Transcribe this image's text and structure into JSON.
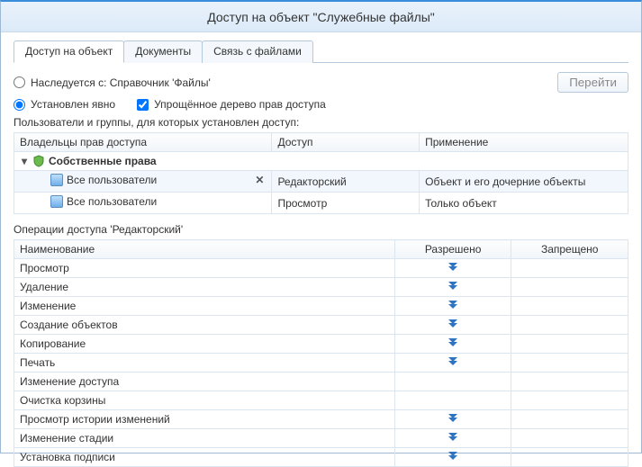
{
  "title": "Доступ на объект \"Служебные файлы\"",
  "tabs": {
    "access": "Доступ на объект",
    "documents": "Документы",
    "files": "Связь с файлами"
  },
  "inherit": {
    "label": "Наследуется с: Справочник 'Файлы'"
  },
  "gotoBtn": "Перейти",
  "explicit": {
    "label": "Установлен явно"
  },
  "simplified": {
    "label": "Упрощённое дерево прав доступа"
  },
  "usersGroupsCaption": "Пользователи и группы, для которых установлен доступ:",
  "rightsTable": {
    "headers": {
      "owner": "Владельцы прав доступа",
      "access": "Доступ",
      "apply": "Применение"
    },
    "group": "Собственные права",
    "rows": [
      {
        "owner": "Все пользователи",
        "access": "Редакторский",
        "apply": "Объект и его дочерние объекты",
        "selected": true
      },
      {
        "owner": "Все пользователи",
        "access": "Просмотр",
        "apply": "Только объект",
        "selected": false
      }
    ]
  },
  "opsCaption": "Операции доступа 'Редакторский'",
  "opsTable": {
    "headers": {
      "name": "Наименование",
      "allowed": "Разрешено",
      "denied": "Запрещено"
    },
    "rows": [
      {
        "name": "Просмотр",
        "allowed": true,
        "denied": false
      },
      {
        "name": "Удаление",
        "allowed": true,
        "denied": false
      },
      {
        "name": "Изменение",
        "allowed": true,
        "denied": false
      },
      {
        "name": "Создание объектов",
        "allowed": true,
        "denied": false
      },
      {
        "name": "Копирование",
        "allowed": true,
        "denied": false
      },
      {
        "name": "Печать",
        "allowed": true,
        "denied": false
      },
      {
        "name": "Изменение доступа",
        "allowed": false,
        "denied": false
      },
      {
        "name": "Очистка корзины",
        "allowed": false,
        "denied": false
      },
      {
        "name": "Просмотр истории изменений",
        "allowed": true,
        "denied": false
      },
      {
        "name": "Изменение стадии",
        "allowed": true,
        "denied": false
      },
      {
        "name": "Установка подписи",
        "allowed": true,
        "denied": false
      }
    ]
  }
}
